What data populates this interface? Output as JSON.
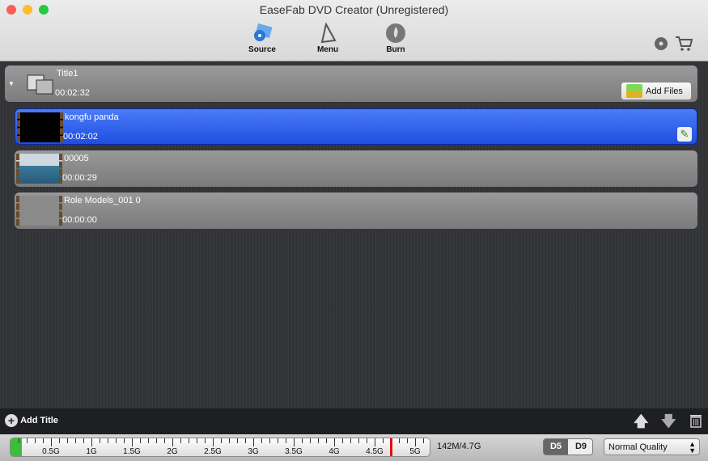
{
  "window": {
    "title": "EaseFab DVD Creator (Unregistered)"
  },
  "toolbar": {
    "tabs": [
      {
        "label": "Source",
        "icon": "source-icon",
        "active": true
      },
      {
        "label": "Menu",
        "icon": "menu-icon"
      },
      {
        "label": "Burn",
        "icon": "burn-icon"
      }
    ]
  },
  "title_group": {
    "name": "Title1",
    "duration": "00:02:32",
    "add_files": "Add Files"
  },
  "items": [
    {
      "name": "kongfu panda",
      "duration": "00:02:02",
      "selected": true
    },
    {
      "name": "00005",
      "duration": "00:00:29"
    },
    {
      "name": "Role Models_001 0",
      "duration": "00:00:00"
    }
  ],
  "bottom": {
    "add_title": "Add Title"
  },
  "status": {
    "ruler_labels": [
      "0.5G",
      "1G",
      "1.5G",
      "2G",
      "2.5G",
      "3G",
      "3.5G",
      "4G",
      "4.5G",
      "5G"
    ],
    "used_gb": 0.142,
    "capacity_gb": 4.7,
    "usage_text": "142M/4.7G",
    "disc_types": [
      "D5",
      "D9"
    ],
    "selected_disc": "D5",
    "quality": "Normal Quality"
  },
  "colors": {
    "selection": "#2f5ff0",
    "limit_marker": "#e01010",
    "used_fill": "#3bbf3b"
  }
}
